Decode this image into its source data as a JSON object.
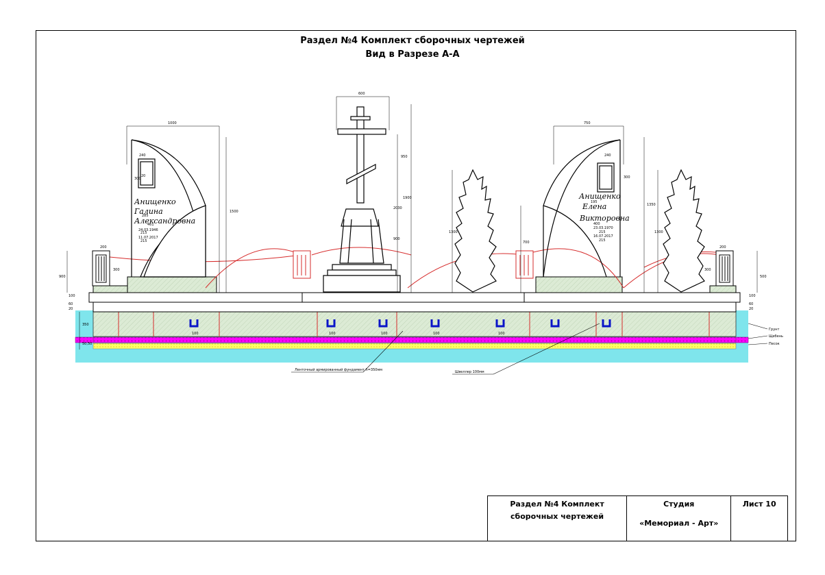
{
  "title": {
    "line1": "Раздел №4 Комплект сборочных чертежей",
    "line2": "Вид в Разрезе А-А"
  },
  "stamp": {
    "section": "Раздел №4 Комплект сборочных чертежей",
    "studio_label": "Студия",
    "studio_name": "«Мемориал - Арт»",
    "sheet": "Лист 10"
  },
  "labels": {
    "foundation": "Ленточный армированный фундамент h=350мм",
    "channel": "Швеллер 100мм",
    "ground": "Грунт",
    "gravel": "Щебень",
    "sand": "Песок"
  },
  "left_stele": {
    "surname": "Анищенко",
    "name": "Галина",
    "patronymic": "Александровна",
    "date1": "24.03.1946",
    "date2": "11.07.2017"
  },
  "right_stele": {
    "surname": "Анищенко",
    "name": "Елена",
    "patronymic": "Викторовна",
    "date1": "23.03.1970",
    "date2": "16.07.2017"
  },
  "dimensions": {
    "left_width": "1000",
    "cross_width": "600",
    "right_width": "750",
    "left_height": "1500",
    "cross_height": "1900",
    "cross_top": "950",
    "cross_mid": "2030",
    "cross_base": "900",
    "right_height": "1350",
    "cypress_left": "1300",
    "cypress_right": "1300",
    "mid_cypress": "700",
    "left_post": "300",
    "right_post": "300",
    "left_post_w": "200",
    "right_post_w": "200",
    "found_h": "350",
    "layer_h": "50,50",
    "channel_label": "100",
    "photo_size": "20",
    "photo_w": "240",
    "photo_h": "300",
    "text_w1": "285",
    "text_w2": "461",
    "text_w3": "215",
    "text_w4": "215",
    "text_w5": "195",
    "text_w6": "400",
    "level1": "100",
    "level2": "60",
    "level3": "20",
    "side_500": "500",
    "side_900": "900"
  },
  "colors": {
    "green_fill": "#dcebd5",
    "water": "#7fe5ec",
    "magenta": "#ff00ff",
    "yellow": "#ffff66",
    "red": "#d62b2b",
    "blue": "#0a14c8"
  }
}
